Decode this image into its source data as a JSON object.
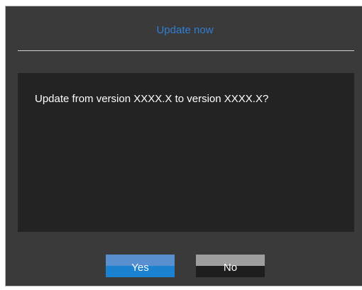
{
  "dialog": {
    "title": "Update now",
    "message": "Update from version XXXX.X to version XXXX.X?"
  },
  "buttons": {
    "yes_label": "Yes",
    "no_label": "No"
  },
  "colors": {
    "title": "#2f7ed3",
    "background": "#3a3a3a",
    "panel": "#232323",
    "yes_button": "#1a82d0",
    "no_button": "#1e1e1e"
  }
}
